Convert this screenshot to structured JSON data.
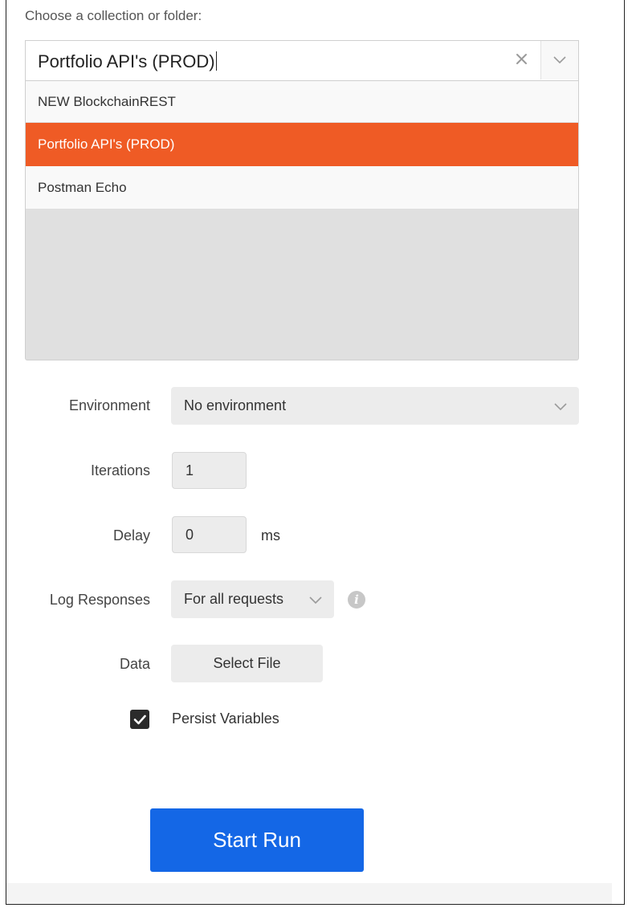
{
  "collection": {
    "label": "Choose a collection or folder:",
    "input_value": "Portfolio API's (PROD)",
    "options": [
      "NEW BlockchainREST",
      "Portfolio API's (PROD)",
      "Postman Echo"
    ],
    "selected_option": "Portfolio API's (PROD)"
  },
  "environment": {
    "label": "Environment",
    "value": "No environment"
  },
  "iterations": {
    "label": "Iterations",
    "value": "1"
  },
  "delay": {
    "label": "Delay",
    "value": "0",
    "unit": "ms"
  },
  "log_responses": {
    "label": "Log Responses",
    "value": "For all requests"
  },
  "data": {
    "label": "Data",
    "button": "Select File"
  },
  "persist": {
    "label": "Persist Variables",
    "checked": true
  },
  "start_button": "Start Run",
  "colors": {
    "selected_option_bg": "#ef5b25",
    "primary_button": "#1467e6"
  },
  "icons": [
    "clear-icon",
    "chevron-down-icon",
    "info-icon",
    "checkmark-icon"
  ]
}
